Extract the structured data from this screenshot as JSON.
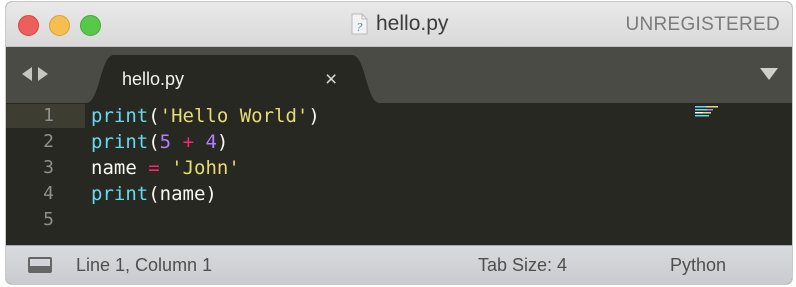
{
  "window": {
    "title": "hello.py",
    "registration_status": "UNREGISTERED"
  },
  "tabbar": {
    "tabs": [
      {
        "label": "hello.py",
        "close_glyph": "×",
        "active": true
      }
    ]
  },
  "editor": {
    "line_numbers": [
      "1",
      "2",
      "3",
      "4",
      "5"
    ],
    "current_line": 1,
    "code": [
      {
        "tokens": [
          {
            "text": "print",
            "kind": "function"
          },
          {
            "text": "(",
            "kind": "plain"
          },
          {
            "text": "'Hello World'",
            "kind": "string"
          },
          {
            "text": ")",
            "kind": "plain"
          }
        ]
      },
      {
        "tokens": [
          {
            "text": "print",
            "kind": "function"
          },
          {
            "text": "(",
            "kind": "plain"
          },
          {
            "text": "5",
            "kind": "number"
          },
          {
            "text": " ",
            "kind": "plain"
          },
          {
            "text": "+",
            "kind": "operator"
          },
          {
            "text": " ",
            "kind": "plain"
          },
          {
            "text": "4",
            "kind": "number"
          },
          {
            "text": ")",
            "kind": "plain"
          }
        ]
      },
      {
        "tokens": [
          {
            "text": "name",
            "kind": "plain"
          },
          {
            "text": " ",
            "kind": "plain"
          },
          {
            "text": "=",
            "kind": "operator"
          },
          {
            "text": " ",
            "kind": "plain"
          },
          {
            "text": "'John'",
            "kind": "string"
          }
        ]
      },
      {
        "tokens": [
          {
            "text": "print",
            "kind": "function"
          },
          {
            "text": "(name)",
            "kind": "plain"
          }
        ]
      },
      {
        "tokens": []
      }
    ]
  },
  "statusbar": {
    "position": "Line 1, Column 1",
    "tab_size": "Tab Size: 4",
    "syntax": "Python"
  },
  "colors": {
    "editor_background": "#272822",
    "function": "#66d9ef",
    "string": "#e6db74",
    "number": "#ae81ff",
    "operator": "#f92672",
    "text": "#f8f8f2"
  },
  "icons": [
    "close-window-light",
    "minimize-window-light",
    "zoom-window-light",
    "python-file-icon",
    "nav-back-icon",
    "nav-forward-icon",
    "close-icon",
    "tab-menu-icon",
    "panel-toggle-icon"
  ]
}
